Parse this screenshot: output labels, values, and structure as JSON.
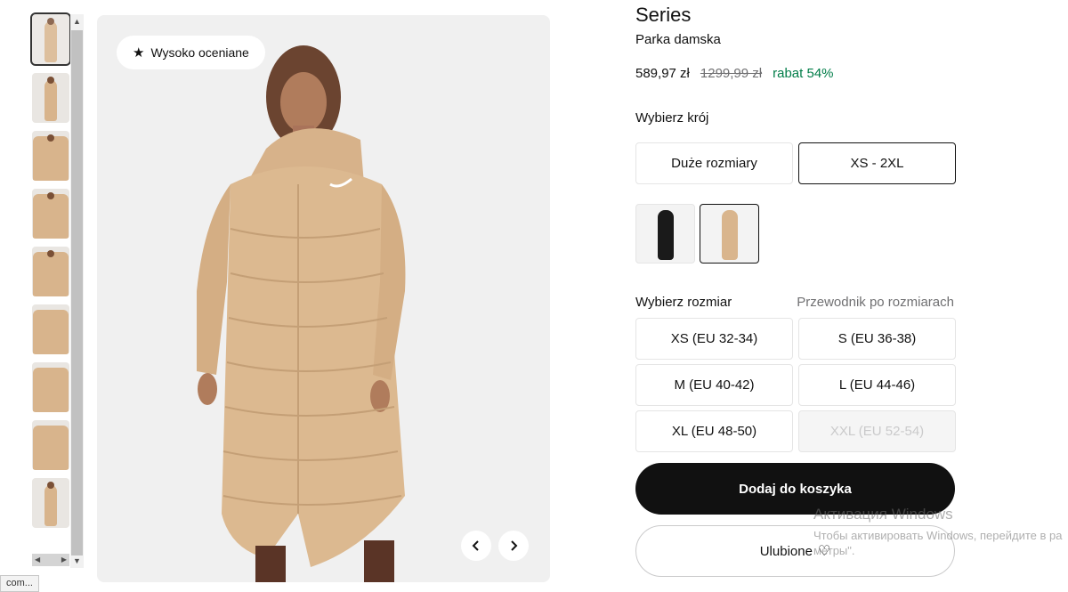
{
  "product": {
    "title": "Series",
    "subtitle": "Parka damska",
    "price_current": "589,97 zł",
    "price_original": "1299,99 zł",
    "discount": "rabat 54%"
  },
  "gallery": {
    "badge": "Wysoko oceniane",
    "badge_icon": "star-icon",
    "prev_icon": "chevron-left-icon",
    "next_icon": "chevron-right-icon",
    "thumbnail_count": 9
  },
  "fit": {
    "label": "Wybierz krój",
    "options": [
      "Duże rozmiary",
      "XS - 2XL"
    ],
    "selected": "XS - 2XL"
  },
  "colors": {
    "swatches": [
      {
        "name": "black",
        "color": "#1a1a1a"
      },
      {
        "name": "beige",
        "color": "#d9b58d"
      }
    ],
    "selected": "beige"
  },
  "sizes": {
    "label": "Wybierz rozmiar",
    "guide": "Przewodnik po rozmiarach",
    "options": [
      {
        "label": "XS (EU 32-34)",
        "available": true
      },
      {
        "label": "S (EU 36-38)",
        "available": true
      },
      {
        "label": "M (EU 40-42)",
        "available": true
      },
      {
        "label": "L (EU 44-46)",
        "available": true
      },
      {
        "label": "XL (EU 48-50)",
        "available": true
      },
      {
        "label": "XXL (EU 52-54)",
        "available": false
      }
    ]
  },
  "actions": {
    "add_to_cart": "Dodaj do koszyka",
    "favorite": "Ulubione",
    "favorite_icon": "heart-icon"
  },
  "browser": {
    "status_url": "com..."
  },
  "os_watermark": {
    "line1": "Активация Windows",
    "line2": "Чтобы активировать Windows, перейдите в ра",
    "line3": "метры\"."
  },
  "colors_theme": {
    "accent_green": "#007d48",
    "primary_black": "#111111",
    "product_beige": "#d9b58d"
  }
}
